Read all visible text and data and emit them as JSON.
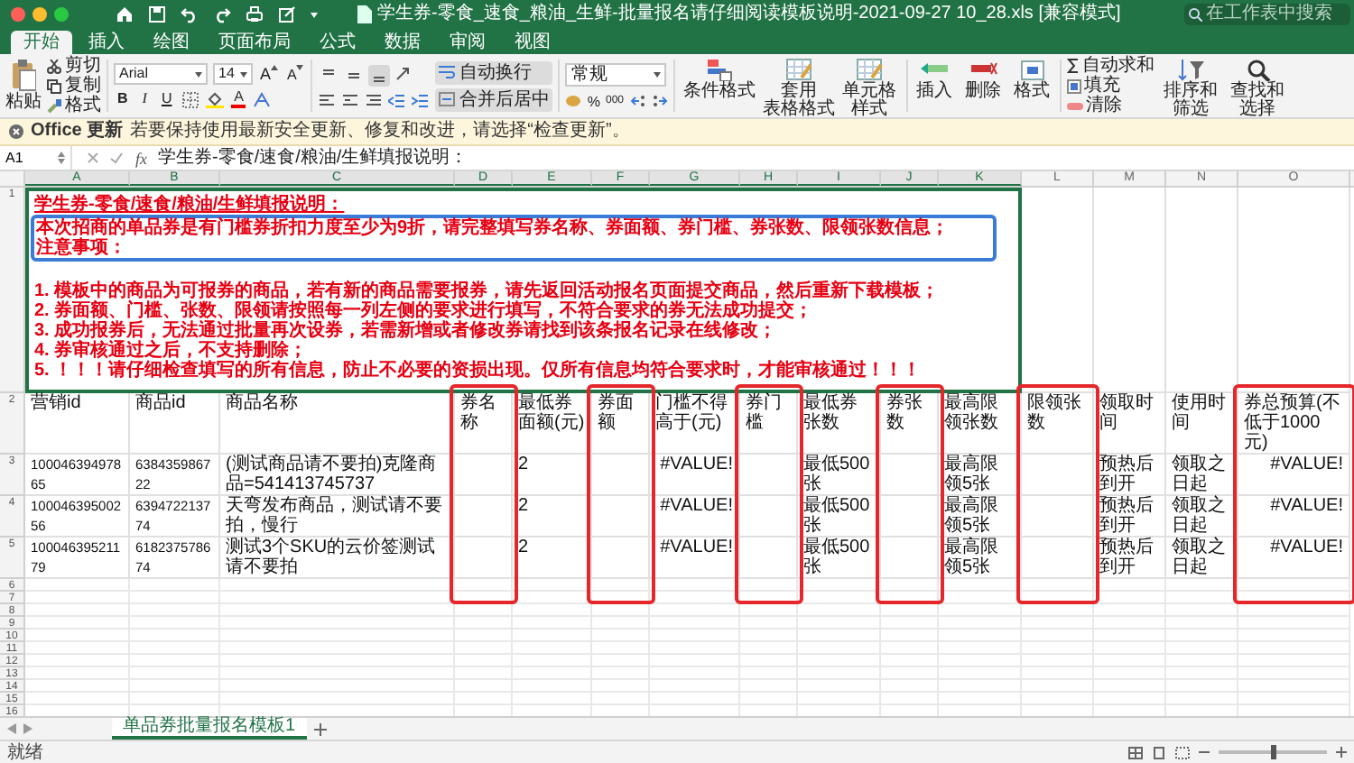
{
  "window": {
    "title": "学生券-零食_速食_粮油_生鲜-批量报名请仔细阅读模板说明-2021-09-27 10_28.xls [兼容模式]",
    "search_placeholder": "在工作表中搜索"
  },
  "ribbon_tabs": [
    {
      "label": "开始",
      "selected": true
    },
    {
      "label": "插入",
      "selected": false
    },
    {
      "label": "绘图",
      "selected": false
    },
    {
      "label": "页面布局",
      "selected": false
    },
    {
      "label": "公式",
      "selected": false
    },
    {
      "label": "数据",
      "selected": false
    },
    {
      "label": "审阅",
      "selected": false
    },
    {
      "label": "视图",
      "selected": false
    }
  ],
  "clipboard": {
    "paste": "粘贴",
    "cut": "剪切",
    "copy": "复制",
    "format_painter": "格式"
  },
  "font": {
    "name": "Arial",
    "size": "14",
    "grow": "A",
    "shrink": "A",
    "bold": "B",
    "italic": "I",
    "underline": "U",
    "font_color": "A"
  },
  "alignment": {
    "vertical": [
      {
        "selected": false
      },
      {
        "selected": false
      },
      {
        "selected": true
      }
    ],
    "wrap_text": {
      "label": "自动换行",
      "on": true
    },
    "merge_center": {
      "label": "合并后居中",
      "on": true
    }
  },
  "number": {
    "format": "常规",
    "percent": "%",
    "comma": "000"
  },
  "styles": [
    {
      "lines": [
        "条件格式"
      ]
    },
    {
      "lines": [
        "套用",
        "表格格式"
      ]
    },
    {
      "lines": [
        "单元格",
        "样式"
      ]
    }
  ],
  "cells": [
    "插入",
    "删除",
    "格式"
  ],
  "editing": {
    "autosum": "自动求和",
    "fill": "填充",
    "clear": "清除",
    "sort": [
      "排序和",
      "筛选"
    ],
    "find": [
      "查找和",
      "选择"
    ]
  },
  "message_bar": {
    "title": "Office 更新",
    "text": "若要保持使用最新安全更新、修复和改进，请选择“检查更新”。"
  },
  "formula_bar": {
    "cell": "A1",
    "fx": "fx",
    "formula": "学生券-零食/速食/粮油/生鲜填报说明："
  },
  "sheet": {
    "columns": [
      {
        "letter": "A",
        "selected": true,
        "highlighted": false
      },
      {
        "letter": "B",
        "selected": true,
        "highlighted": false
      },
      {
        "letter": "C",
        "selected": true,
        "highlighted": false
      },
      {
        "letter": "D",
        "selected": true,
        "highlighted": true
      },
      {
        "letter": "E",
        "selected": true,
        "highlighted": false
      },
      {
        "letter": "F",
        "selected": true,
        "highlighted": true
      },
      {
        "letter": "G",
        "selected": true,
        "highlighted": false
      },
      {
        "letter": "H",
        "selected": true,
        "highlighted": true
      },
      {
        "letter": "I",
        "selected": true,
        "highlighted": false
      },
      {
        "letter": "J",
        "selected": true,
        "highlighted": true
      },
      {
        "letter": "K",
        "selected": true,
        "highlighted": false
      },
      {
        "letter": "L",
        "selected": false,
        "highlighted": true
      },
      {
        "letter": "M",
        "selected": false,
        "highlighted": false
      },
      {
        "letter": "N",
        "selected": false,
        "highlighted": false
      },
      {
        "letter": "O",
        "selected": false,
        "highlighted": true
      }
    ],
    "notes": {
      "number": "1",
      "selected": true,
      "title": "学生券-零食/速食/粮油/生鲜填报说明：",
      "intro": {
        "highlighted": true,
        "lines": [
          "本次招商的单品券是有门槛券折扣力度至少为9折，请完整填写券名称、券面额、券门槛、券张数、限领张数信息；",
          "注意事项："
        ]
      },
      "rules": [
        "1. 模板中的商品为可报券的商品，若有新的商品需要报券，请先返回活动报名页面提交商品，然后重新下载模板；",
        "2. 券面额、门槛、张数、限领请按照每一列左侧的要求进行填写，不符合要求的券无法成功提交；",
        "3. 成功报券后，无法通过批量再次设券，若需新增或者修改券请找到该条报名记录在线修改；",
        "4. 券审核通过之后，不支持删除；",
        "5. ！！！请仔细检查填写的所有信息，防止不必要的资损出现。仅所有信息均符合要求时，才能审核通过！！！"
      ]
    },
    "header_row": {
      "number": "2",
      "cells": [
        "营销id",
        "商品id",
        "商品名称",
        "券名称",
        "最低券面额(元)",
        "券面额",
        "门槛不得高于(元)",
        "券门槛",
        "最低券张数",
        "券张数",
        "最高限领张数",
        "限领张数",
        "领取时间",
        "使用时间",
        "券总预算(不低于1000元)"
      ]
    },
    "rows": [
      {
        "number": "3",
        "cells": {
          "A": "10004639497865",
          "B": "638435986722",
          "C": "(测试商品请不要拍)克隆商品=541413745737",
          "E": "2",
          "G": "#VALUE!",
          "I": "最低500张",
          "K": "最高限领5张",
          "M": "预热后到开",
          "N": "领取之日起",
          "O": "#VALUE!"
        }
      },
      {
        "number": "4",
        "cells": {
          "A": "10004639500256",
          "B": "639472213774",
          "C": "天弯发布商品，测试请不要拍，慢行",
          "E": "2",
          "G": "#VALUE!",
          "I": "最低500张",
          "K": "最高限领5张",
          "M": "预热后到开",
          "N": "领取之日起",
          "O": "#VALUE!"
        }
      },
      {
        "number": "5",
        "cells": {
          "A": "10004639521179",
          "B": "618237578674",
          "C": "测试3个SKU的云价签测试请不要拍",
          "E": "2",
          "G": "#VALUE!",
          "I": "最低500张",
          "K": "最高限领5张",
          "M": "预热后到开",
          "N": "领取之日起",
          "O": "#VALUE!"
        }
      }
    ],
    "empty_rows": [
      "6",
      "7",
      "8",
      "9",
      "10",
      "11",
      "12",
      "13",
      "14",
      "15",
      "16"
    ]
  },
  "sheet_tabs": [
    {
      "label": "单品券批量报名模板1",
      "selected": true
    }
  ],
  "status_bar": {
    "status": "就绪",
    "zoom": {
      "level": 0.5
    }
  }
}
